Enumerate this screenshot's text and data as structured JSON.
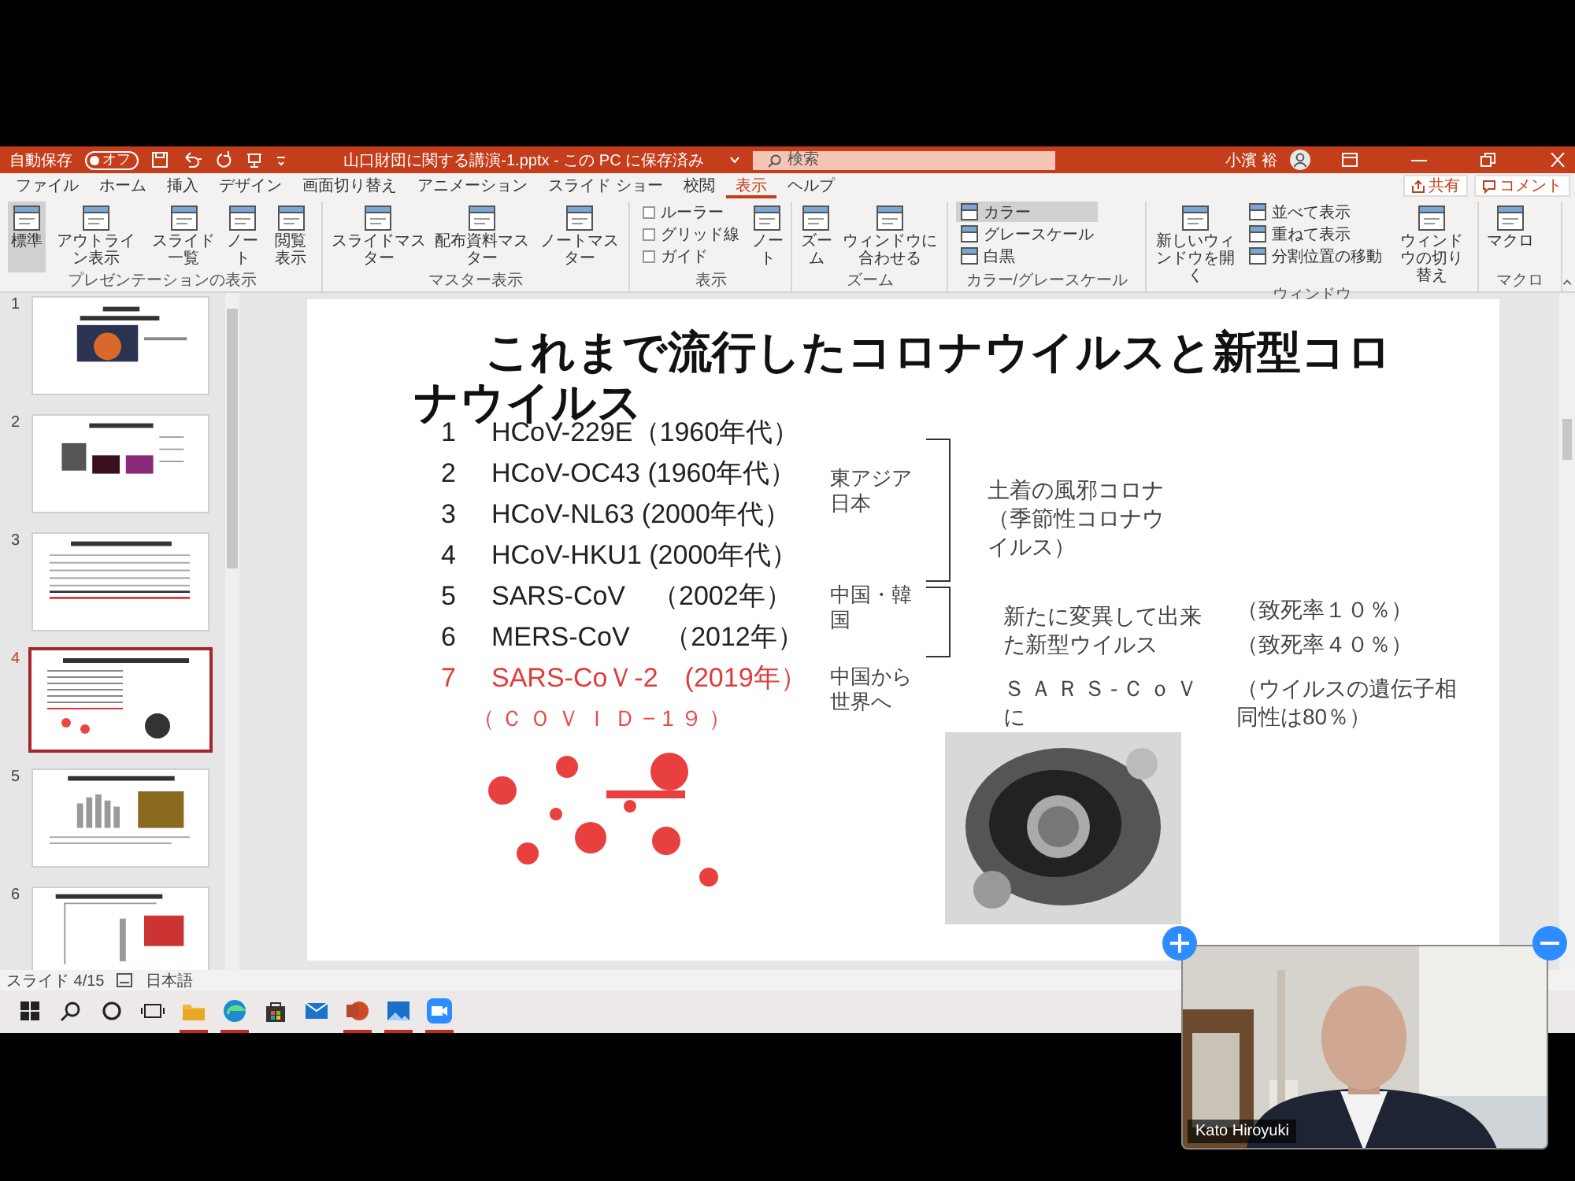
{
  "title_bar": {
    "autosave_label": "自動保存",
    "autosave_toggle": {
      "label": "オフ",
      "on": false
    },
    "document_title": "山口財団に関する講演-1.pptx - この PC に保存済み",
    "search": {
      "placeholder": "検索"
    },
    "user_name": "小濱 裕"
  },
  "ribbon_tabs": [
    {
      "label": "ファイル",
      "selected": false
    },
    {
      "label": "ホーム",
      "selected": false
    },
    {
      "label": "挿入",
      "selected": false
    },
    {
      "label": "デザイン",
      "selected": false
    },
    {
      "label": "画面切り替え",
      "selected": false
    },
    {
      "label": "アニメーション",
      "selected": false
    },
    {
      "label": "スライド ショー",
      "selected": false
    },
    {
      "label": "校閲",
      "selected": false
    },
    {
      "label": "表示",
      "selected": true
    },
    {
      "label": "ヘルプ",
      "selected": false
    }
  ],
  "ribbon_actions": [
    "共有",
    "コメント"
  ],
  "ribbon_groups": [
    {
      "label": "プレゼンテーションの表示",
      "items": [
        {
          "kind": "large",
          "label": "標準",
          "selected": true
        },
        {
          "kind": "large",
          "label": "アウトライン表示",
          "selected": false
        },
        {
          "kind": "large",
          "label": "スライド一覧",
          "selected": false
        },
        {
          "kind": "large",
          "label": "ノート",
          "selected": false
        },
        {
          "kind": "large",
          "label": "閲覧表示",
          "selected": false
        }
      ]
    },
    {
      "label": "マスター表示",
      "items": [
        {
          "kind": "large",
          "label": "スライドマスター"
        },
        {
          "kind": "large",
          "label": "配布資料マスター"
        },
        {
          "kind": "large",
          "label": "ノートマスター"
        }
      ]
    },
    {
      "label": "表示",
      "items": [
        {
          "kind": "check",
          "label": "ルーラー",
          "checked": false
        },
        {
          "kind": "check",
          "label": "グリッド線",
          "checked": false
        },
        {
          "kind": "check",
          "label": "ガイド",
          "checked": false
        },
        {
          "kind": "large",
          "label": "ノート"
        }
      ]
    },
    {
      "label": "ズーム",
      "items": [
        {
          "kind": "large",
          "label": "ズーム"
        },
        {
          "kind": "large",
          "label": "ウィンドウに合わせる"
        }
      ]
    },
    {
      "label": "カラー/グレースケール",
      "items": [
        {
          "kind": "small",
          "label": "カラー",
          "selected": true
        },
        {
          "kind": "small",
          "label": "グレースケール",
          "selected": false
        },
        {
          "kind": "small",
          "label": "白黒",
          "selected": false
        }
      ]
    },
    {
      "label": "ウィンドウ",
      "items": [
        {
          "kind": "large",
          "label": "新しいウィンドウを開く"
        },
        {
          "kind": "small",
          "label": "並べて表示"
        },
        {
          "kind": "small",
          "label": "重ねて表示"
        },
        {
          "kind": "small",
          "label": "分割位置の移動"
        },
        {
          "kind": "large",
          "label": "ウィンドウの切り替え"
        }
      ]
    },
    {
      "label": "マクロ",
      "items": [
        {
          "kind": "large",
          "label": "マクロ"
        }
      ]
    }
  ],
  "slides": [
    {
      "number": "1",
      "selected": false
    },
    {
      "number": "2",
      "selected": false
    },
    {
      "number": "3",
      "selected": false
    },
    {
      "number": "4",
      "selected": true
    },
    {
      "number": "5",
      "selected": false
    },
    {
      "number": "6",
      "selected": false
    }
  ],
  "slide": {
    "title": "これまで流行したコロナウイルスと新型コロナウイルス",
    "items": [
      {
        "number": "1",
        "text": "HCoV-229E（1960年代）",
        "color": "#222222"
      },
      {
        "number": "2",
        "text": "HCoV-OC43 (1960年代）",
        "color": "#222222"
      },
      {
        "number": "3",
        "text": "HCoV-NL63 (2000年代）",
        "color": "#222222"
      },
      {
        "number": "4",
        "text": "HCoV-HKU1 (2000年代）",
        "color": "#222222"
      },
      {
        "number": "5",
        "text": "SARS-CoV　（2002年）",
        "color": "#222222"
      },
      {
        "number": "6",
        "text": "MERS-CoV　 （2012年）",
        "color": "#222222"
      },
      {
        "number": "7",
        "text": "SARS-CoＶ-2　(2019年）",
        "color": "#e03c3c"
      }
    ],
    "region_labels": [
      "東アジア日本",
      "中国・韓国",
      "中国から世界へ"
    ],
    "group_notes": [
      "土着の風邪コロナ（季節性コロナウイルス）",
      "新たに変異して出来た新型ウイルス",
      "ＳＡＲＳ-ＣｏＶに"
    ],
    "side_notes": [
      "（致死率１０％）",
      "（致死率４０％）",
      "（ウイルスの遺伝子相同性は80％）"
    ],
    "covid_label": "（ＣＯＶＩＤ−1９）"
  },
  "status_bar": {
    "slide_position": "スライド 4/15",
    "language": "日本語"
  },
  "taskbar": [
    {
      "kind": "start",
      "running": false
    },
    {
      "kind": "search",
      "running": false
    },
    {
      "kind": "cortana",
      "running": false
    },
    {
      "kind": "taskview",
      "running": false
    },
    {
      "kind": "files",
      "running": true
    },
    {
      "kind": "browser",
      "running": true
    },
    {
      "kind": "store",
      "running": false
    },
    {
      "kind": "mail",
      "running": false
    },
    {
      "kind": "slides",
      "running": true
    },
    {
      "kind": "photos",
      "running": true
    },
    {
      "kind": "video",
      "running": true
    }
  ],
  "video_tile": {
    "name": "Kato Hiroyuki"
  }
}
